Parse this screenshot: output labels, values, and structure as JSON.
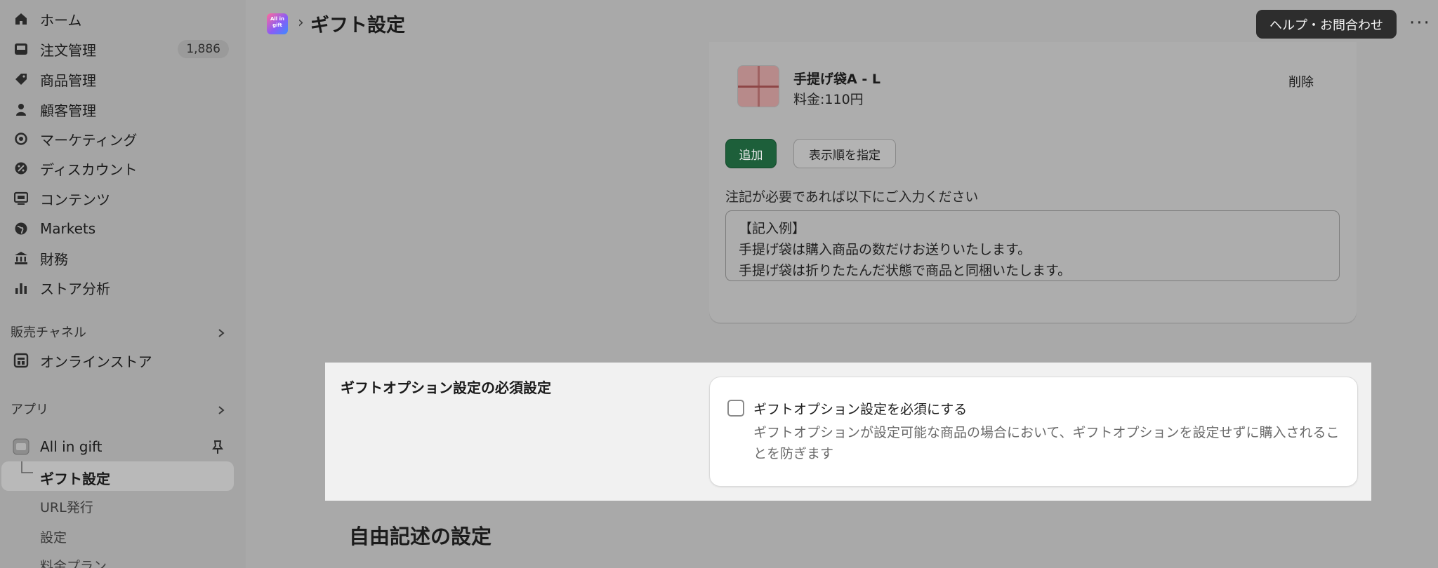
{
  "sidebar": {
    "items": [
      {
        "label": "ホーム",
        "icon": "home-icon"
      },
      {
        "label": "注文管理",
        "icon": "inbox-icon",
        "badge": "1,886"
      },
      {
        "label": "商品管理",
        "icon": "tag-icon"
      },
      {
        "label": "顧客管理",
        "icon": "person-icon"
      },
      {
        "label": "マーケティング",
        "icon": "target-icon"
      },
      {
        "label": "ディスカウント",
        "icon": "discount-icon"
      },
      {
        "label": "コンテンツ",
        "icon": "content-icon"
      },
      {
        "label": "Markets",
        "icon": "globe-icon"
      },
      {
        "label": "財務",
        "icon": "bank-icon"
      },
      {
        "label": "ストア分析",
        "icon": "bar-chart-icon"
      }
    ],
    "sales_channels": {
      "heading": "販売チャネル",
      "items": [
        {
          "label": "オンラインストア",
          "icon": "store-icon"
        }
      ]
    },
    "apps": {
      "heading": "アプリ",
      "app_name": "All in gift",
      "sub_items": [
        "ギフト設定",
        "URL発行",
        "設定",
        "料金プラン"
      ]
    }
  },
  "topbar": {
    "logo_text": "All in gift",
    "separator": "›",
    "title": "ギフト設定",
    "help_label": "ヘルプ・お問合わせ",
    "more_label": "···"
  },
  "bag_card": {
    "product_name": "手提げ袋A - L",
    "product_price": "料金:110円",
    "delete_label": "削除",
    "add_label": "追加",
    "order_label": "表示順を指定",
    "note_label": "注記が必要であれば以下にご入力ください",
    "note_lines": [
      "【記入例】",
      "手提げ袋は購入商品の数だけお送りいたします。",
      "手提げ袋は折りたたんだ状態で商品と同梱いたします。"
    ]
  },
  "required_section": {
    "title": "ギフトオプション設定の必須設定",
    "checkbox_label": "ギフトオプション設定を必須にする",
    "checked": false,
    "help_text": "ギフトオプションが設定可能な商品の場合において、ギフトオプションを設定せずに購入されることを防ぎます"
  },
  "free_text_section": {
    "title": "自由記述の設定"
  }
}
